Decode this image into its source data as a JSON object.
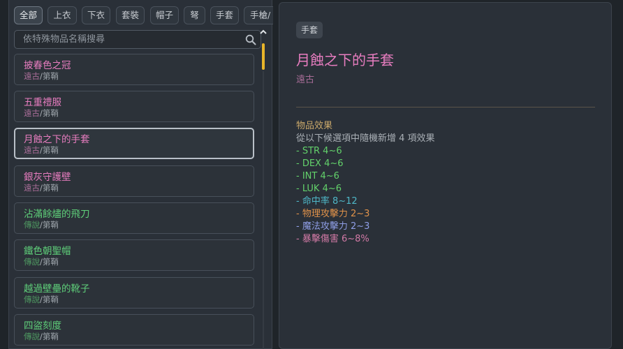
{
  "categories": [
    "全部",
    "上衣",
    "下衣",
    "套裝",
    "帽子",
    "弩",
    "手套",
    "手槍/"
  ],
  "active_category": 0,
  "search": {
    "placeholder": "依特殊物品名稱搜尋"
  },
  "items": [
    {
      "name": "披春色之冠",
      "rarity": "遠古",
      "type": "第鞘",
      "name_color": "#e87dc0",
      "rarity_color": "#a86d98"
    },
    {
      "name": "五重禮服",
      "rarity": "遠古",
      "type": "第鞘",
      "name_color": "#e87dc0",
      "rarity_color": "#a86d98"
    },
    {
      "name": "月蝕之下的手套",
      "rarity": "遠古",
      "type": "第鞘",
      "name_color": "#e87dc0",
      "rarity_color": "#a86d98",
      "selected": true
    },
    {
      "name": "銀灰守護壁",
      "rarity": "遠古",
      "type": "第鞘",
      "name_color": "#e87dc0",
      "rarity_color": "#a86d98"
    },
    {
      "name": "沾滿餘燼的飛刀",
      "rarity": "傳說",
      "type": "第鞘",
      "name_color": "#5fd07a",
      "rarity_color": "#4f9b62"
    },
    {
      "name": "鐵色朝聖帽",
      "rarity": "傳說",
      "type": "第鞘",
      "name_color": "#5fd07a",
      "rarity_color": "#4f9b62"
    },
    {
      "name": "越過壁壘的靴子",
      "rarity": "傳說",
      "type": "第鞘",
      "name_color": "#5fd07a",
      "rarity_color": "#4f9b62"
    },
    {
      "name": "四盜刻度",
      "rarity": "傳說",
      "type": "第鞘",
      "name_color": "#5fd07a",
      "rarity_color": "#4f9b62"
    }
  ],
  "detail": {
    "tag": "手套",
    "title": "月蝕之下的手套",
    "rarity": "遠古",
    "effects_header": "物品效果",
    "effects_desc": "從以下候選項中隨機新增 4 項效果",
    "effects": [
      {
        "text": "- STR 4~6",
        "color": "#63d26b"
      },
      {
        "text": "- DEX 4~6",
        "color": "#63d26b"
      },
      {
        "text": "- INT 4~6",
        "color": "#63d26b"
      },
      {
        "text": "- LUK 4~6",
        "color": "#63d26b"
      },
      {
        "text": "- 命中率 8~12",
        "color": "#4fb7c7"
      },
      {
        "text": "- 物理攻擊力 2~3",
        "color": "#e0924a"
      },
      {
        "text": "- 魔法攻擊力 2~3",
        "color": "#8f9ee6"
      },
      {
        "text": "- 暴擊傷害 6~8%",
        "color": "#d27aa6"
      }
    ]
  }
}
